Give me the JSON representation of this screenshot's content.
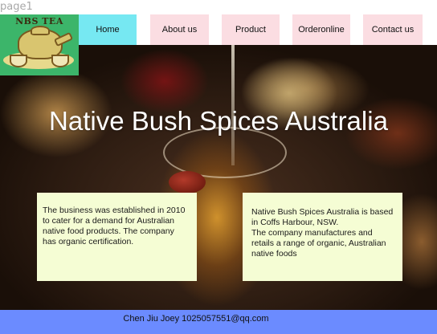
{
  "page_label": "page1",
  "logo": {
    "text": "NBS TEA"
  },
  "nav": {
    "home": "Home",
    "about": "About us",
    "product": "Product",
    "order": "Orderonline",
    "contact": "Contact us",
    "active": "Home"
  },
  "hero": {
    "title": "Native Bush Spices Australia"
  },
  "info": {
    "left": "The business was established in 2010 to cater for a demand for Australian native food products. The company has organic certification.",
    "right_line1": "Native Bush Spices Australia is based in Coffs Harbour, NSW.",
    "right_line2": "The company manufactures and retails a range of organic, Australian native foods"
  },
  "footer": {
    "text": "Chen Jiu Joey 1025057551@qq.com"
  },
  "colors": {
    "nav_active": "#76e8f2",
    "nav_inactive": "#fbdde2",
    "info_box": "#f5fdd4",
    "footer": "#6b8bff",
    "logo_bg": "#3cb56a"
  }
}
